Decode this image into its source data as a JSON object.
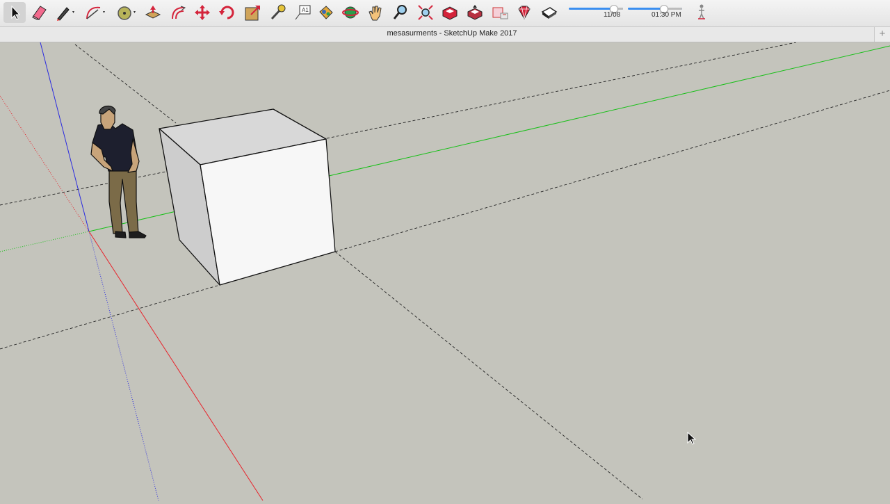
{
  "toolbar": {
    "tools": [
      {
        "name": "select-tool",
        "icon": "arrow-cursor-icon",
        "active": true
      },
      {
        "name": "eraser-tool",
        "icon": "eraser-icon"
      },
      {
        "name": "line-tool",
        "icon": "pencil-icon",
        "dropdown": true
      },
      {
        "name": "arc-tool",
        "icon": "arc-icon",
        "dropdown": true
      },
      {
        "name": "shapes-tool",
        "icon": "circle-shape-icon",
        "dropdown": true
      },
      {
        "name": "push-pull-tool",
        "icon": "push-pull-icon"
      },
      {
        "name": "offset-tool",
        "icon": "offset-icon"
      },
      {
        "name": "move-tool",
        "icon": "move-arrows-icon"
      },
      {
        "name": "rotate-tool",
        "icon": "rotate-icon"
      },
      {
        "name": "scale-tool",
        "icon": "scale-icon"
      },
      {
        "name": "tape-measure-tool",
        "icon": "tape-measure-icon"
      },
      {
        "name": "text-tool",
        "icon": "text-label-icon"
      },
      {
        "name": "paint-bucket-tool",
        "icon": "paint-bucket-icon"
      },
      {
        "name": "orbit-tool",
        "icon": "orbit-icon"
      },
      {
        "name": "pan-tool",
        "icon": "hand-icon"
      },
      {
        "name": "zoom-tool",
        "icon": "magnifier-icon"
      },
      {
        "name": "zoom-extents-tool",
        "icon": "zoom-extents-icon"
      },
      {
        "name": "warehouse-tool",
        "icon": "3d-warehouse-icon"
      },
      {
        "name": "share-model-tool",
        "icon": "share-model-icon"
      },
      {
        "name": "get-models-tool",
        "icon": "get-models-icon"
      },
      {
        "name": "extension-warehouse-tool",
        "icon": "ruby-gem-icon"
      },
      {
        "name": "layout-tool",
        "icon": "layout-icon"
      }
    ],
    "date_label": "11/08",
    "time_label": "01:30 PM",
    "date_fraction": 0.82,
    "time_fraction": 0.66
  },
  "window": {
    "title": "mesasurments  - SketchUp Make 2017",
    "add_button": "+"
  },
  "colors": {
    "background": "#c4c4bc",
    "red_axis": "#e8232b",
    "green_axis": "#18c018",
    "blue_axis": "#2a2ae0",
    "slider_accent": "#3a8ef0"
  }
}
